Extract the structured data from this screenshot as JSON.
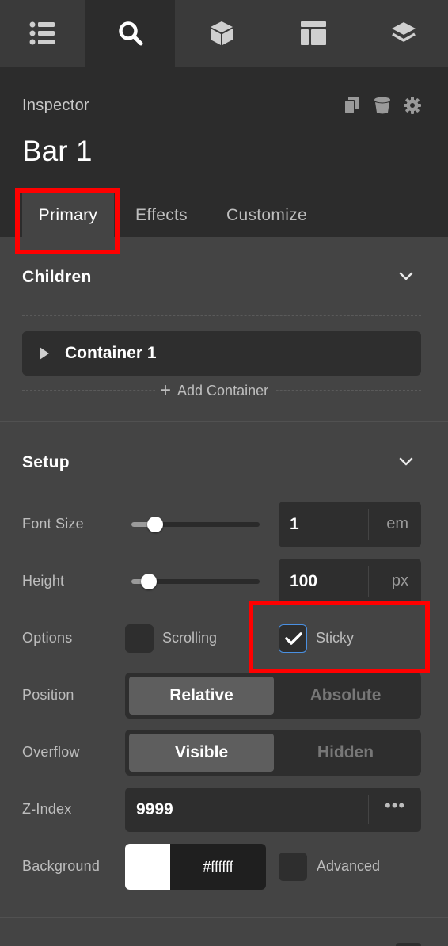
{
  "toolbar": {
    "buttons": [
      {
        "icon": "list-icon"
      },
      {
        "icon": "search-icon",
        "active": true
      },
      {
        "icon": "cube-icon"
      },
      {
        "icon": "layout-icon"
      },
      {
        "icon": "layers-icon"
      }
    ]
  },
  "header": {
    "inspector_label": "Inspector",
    "title": "Bar 1",
    "icons": [
      "copy-icon",
      "trash-icon",
      "gear-icon"
    ]
  },
  "tabs": [
    {
      "label": "Primary",
      "active": true
    },
    {
      "label": "Effects"
    },
    {
      "label": "Customize"
    }
  ],
  "children_section": {
    "title": "Children",
    "items": [
      {
        "label": "Container 1"
      }
    ],
    "add_label": "Add Container"
  },
  "setup_section": {
    "title": "Setup",
    "font_size": {
      "label": "Font Size",
      "value": "1",
      "unit": "em",
      "slider_level": 0.15
    },
    "height": {
      "label": "Height",
      "value": "100",
      "unit": "px",
      "slider_level": 0.1
    },
    "options": {
      "label": "Options",
      "scrolling": {
        "label": "Scrolling",
        "checked": false
      },
      "sticky": {
        "label": "Sticky",
        "checked": true
      }
    },
    "position": {
      "label": "Position",
      "options": [
        "Relative",
        "Absolute"
      ],
      "selected": "Relative"
    },
    "overflow": {
      "label": "Overflow",
      "options": [
        "Visible",
        "Hidden"
      ],
      "selected": "Visible"
    },
    "z_index": {
      "label": "Z-Index",
      "value": "9999",
      "more": "•••"
    },
    "background": {
      "label": "Background",
      "color": "#ffffff",
      "hex": "#ffffff",
      "advanced_label": "Advanced",
      "advanced_checked": false
    }
  },
  "colors": {
    "highlight": "#ff0000",
    "panel_bg": "#444444",
    "header_bg": "#2c2c2c",
    "checkbox_accent": "#4a90e2"
  }
}
